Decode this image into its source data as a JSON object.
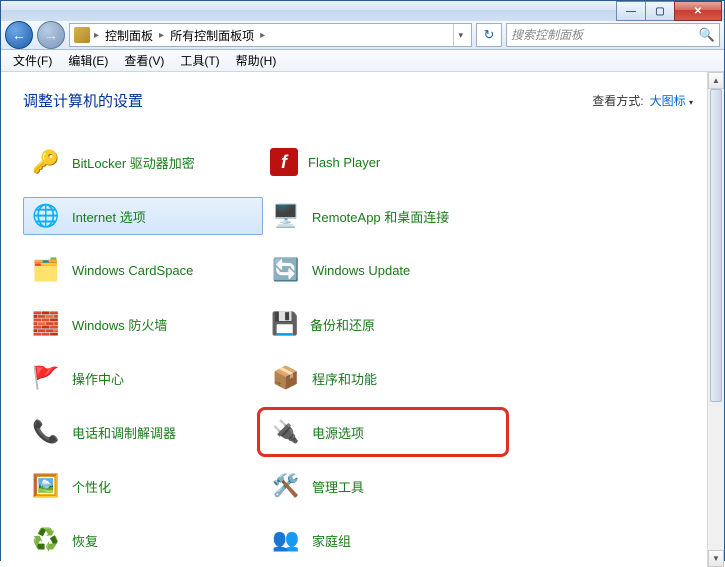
{
  "titlebar": {
    "minimize": "—",
    "maximize": "▢",
    "close": "✕"
  },
  "nav": {
    "back": "←",
    "forward": "→"
  },
  "breadcrumb": {
    "sep": "▸",
    "root": "",
    "item1": "控制面板",
    "item2": "所有控制面板项",
    "dropdown": "▾"
  },
  "refresh_glyph": "↻",
  "search": {
    "placeholder": "搜索控制面板",
    "icon": "🔍"
  },
  "menu": {
    "file": "文件(F)",
    "edit": "编辑(E)",
    "view": "查看(V)",
    "tools": "工具(T)",
    "help": "帮助(H)"
  },
  "page_title": "调整计算机的设置",
  "view_mode": {
    "label": "查看方式:",
    "value": "大图标",
    "arrow": "▾"
  },
  "items": [
    {
      "label": "BitLocker 驱动器加密",
      "icon": "🔑",
      "selected": false,
      "highlighted": false
    },
    {
      "label": "Flash Player",
      "icon": "f",
      "selected": false,
      "highlighted": false
    },
    {
      "label": "Internet 选项",
      "icon": "🌐",
      "selected": true,
      "highlighted": false
    },
    {
      "label": "RemoteApp 和桌面连接",
      "icon": "🖥️",
      "selected": false,
      "highlighted": false
    },
    {
      "label": "Windows CardSpace",
      "icon": "🗂️",
      "selected": false,
      "highlighted": false
    },
    {
      "label": "Windows Update",
      "icon": "🔄",
      "selected": false,
      "highlighted": false
    },
    {
      "label": "Windows 防火墙",
      "icon": "🧱",
      "selected": false,
      "highlighted": false
    },
    {
      "label": "备份和还原",
      "icon": "💾",
      "selected": false,
      "highlighted": false
    },
    {
      "label": "操作中心",
      "icon": "🚩",
      "selected": false,
      "highlighted": false
    },
    {
      "label": "程序和功能",
      "icon": "📦",
      "selected": false,
      "highlighted": false
    },
    {
      "label": "电话和调制解调器",
      "icon": "📞",
      "selected": false,
      "highlighted": false
    },
    {
      "label": "电源选项",
      "icon": "🔌",
      "selected": false,
      "highlighted": true
    },
    {
      "label": "个性化",
      "icon": "🖼️",
      "selected": false,
      "highlighted": false
    },
    {
      "label": "管理工具",
      "icon": "🛠️",
      "selected": false,
      "highlighted": false
    },
    {
      "label": "恢复",
      "icon": "♻️",
      "selected": false,
      "highlighted": false
    },
    {
      "label": "家庭组",
      "icon": "👥",
      "selected": false,
      "highlighted": false
    }
  ],
  "scrollbar": {
    "up": "▲",
    "down": "▼"
  }
}
